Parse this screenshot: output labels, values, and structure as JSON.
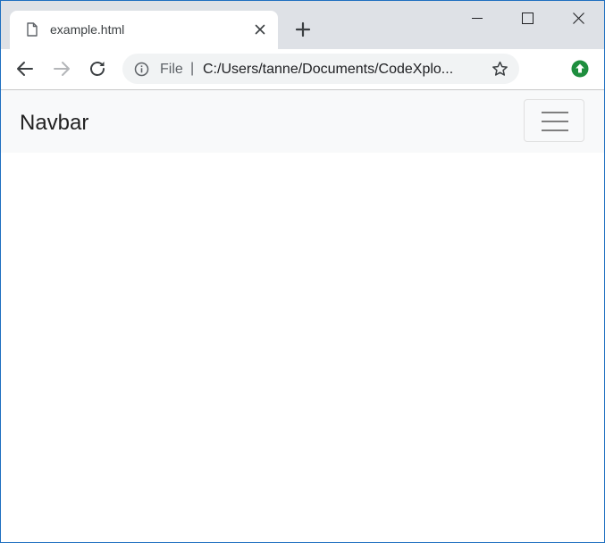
{
  "tab": {
    "title": "example.html"
  },
  "address_bar": {
    "scheme_label": "File",
    "separator": "|",
    "url": "C:/Users/tanne/Documents/CodeXplo..."
  },
  "page": {
    "navbar": {
      "brand": "Navbar"
    }
  },
  "icons": {
    "tab": "file-icon",
    "tab_close": "close-icon",
    "new_tab": "plus-icon",
    "back": "arrow-left-icon",
    "forward": "arrow-right-icon",
    "reload": "reload-icon",
    "site_info": "info-icon",
    "bookmark": "star-icon",
    "update": "update-icon",
    "menu": "hamburger-icon"
  },
  "colors": {
    "tabstrip_bg": "#dee1e6",
    "omnibox_bg": "#f1f3f4",
    "navbar_bg": "#f8f9fa",
    "update_green": "#1e8e3e",
    "window_border": "#1f6fc0"
  }
}
